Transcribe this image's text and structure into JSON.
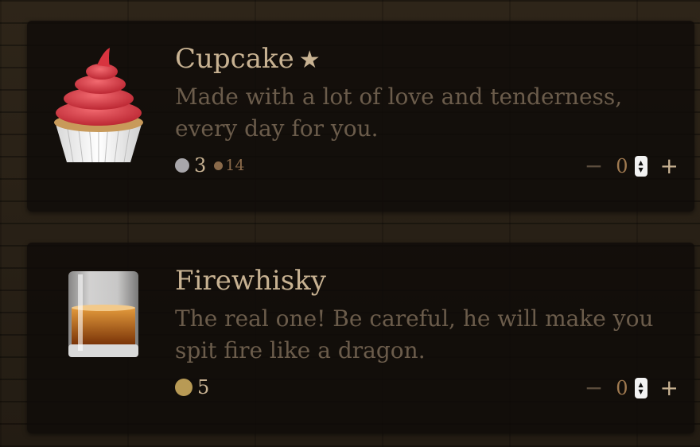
{
  "items": [
    {
      "name": "Cupcake",
      "star": "★",
      "description": "Made with a lot of love and tenderness, every day for you.",
      "prices": {
        "primary": "3",
        "secondary": "14"
      },
      "qty": {
        "minus": "−",
        "value": "0",
        "plus": "+"
      }
    },
    {
      "name": "Firewhisky",
      "description": "The real one! Be careful, he will make you spit fire like a dragon.",
      "prices": {
        "primary": "5"
      },
      "qty": {
        "minus": "−",
        "value": "0",
        "plus": "+"
      }
    }
  ],
  "colors": {
    "silver": "#a8a6aa",
    "bronze": "#8a6a4a",
    "gold": "#b89a55"
  },
  "icons": [
    "cupcake-icon",
    "whisky-glass-icon",
    "silver-coin-icon",
    "bronze-coin-icon",
    "gold-coin-icon"
  ]
}
